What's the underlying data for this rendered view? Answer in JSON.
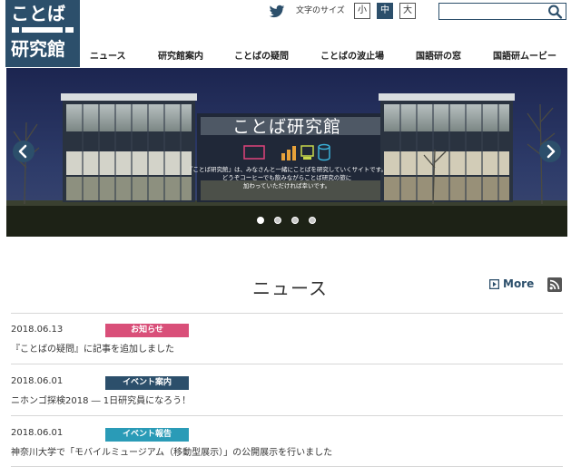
{
  "logo": {
    "line1": "ことば",
    "line2": "研究館"
  },
  "header": {
    "font_size_label": "文字のサイズ",
    "font_sizes": [
      "小",
      "中",
      "大"
    ],
    "active_font_size": "中",
    "search_placeholder": ""
  },
  "nav": [
    "ニュース",
    "研究館案内",
    "ことばの疑問",
    "ことばの波止場",
    "国語研の窓",
    "国語研ムービー"
  ],
  "hero": {
    "title": "ことば研究館",
    "desc_line1": "『ことば研究館』は、みなさんと一緒にことばを研究していくサイトです。",
    "desc_line2": "どうぞコーヒーでも飲みながらことば研究の旅に",
    "desc_line3": "加わっていただければ幸いです。",
    "slide_count": 4,
    "active_slide": 1
  },
  "news": {
    "title": "ニュース",
    "more_label": "More",
    "items": [
      {
        "date": "2018.06.13",
        "category": "お知らせ",
        "text": "『ことばの疑問』に記事を追加しました"
      },
      {
        "date": "2018.06.01",
        "category": "イベント案内",
        "text": "ニホンゴ探検2018 ― 1日研究員になろう！"
      },
      {
        "date": "2018.06.01",
        "category": "イベント報告",
        "text": "神奈川大学で「モバイルミュージアム（移動型展示）」の公開展示を行いました"
      }
    ]
  },
  "colors": {
    "brand": "#2c4f6b",
    "badge_oshirase": "#d94f79",
    "badge_event_annai": "#2c4f6b",
    "badge_event_houkoku": "#2a9bb7"
  }
}
